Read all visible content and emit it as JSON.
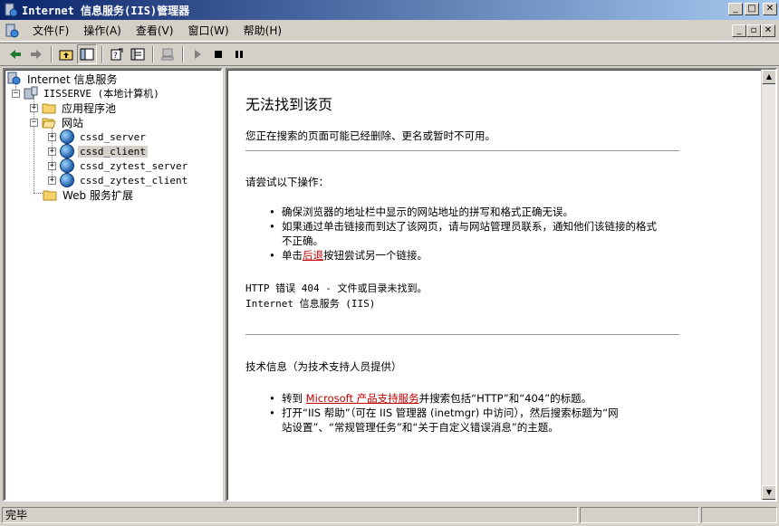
{
  "window": {
    "title": "Internet 信息服务(IIS)管理器",
    "minimize": "_",
    "maximize": "□",
    "close": "✕"
  },
  "menu": {
    "items": [
      "文件(F)",
      "操作(A)",
      "查看(V)",
      "窗口(W)",
      "帮助(H)"
    ],
    "restore_buttons": [
      "_",
      "▫",
      "✕"
    ]
  },
  "toolbar": {
    "icons": [
      "back-icon",
      "forward-icon",
      "up-folder-icon",
      "show-hide-tree-icon",
      "properties-icon",
      "export-list-icon",
      "computer-icon",
      "play-icon",
      "stop-icon",
      "pause-icon"
    ]
  },
  "tree": {
    "root": "Internet 信息服务",
    "server": "IISSERVE (本地计算机)",
    "app_pools": "应用程序池",
    "websites": "网站",
    "sites": [
      "cssd_server",
      "cssd_client",
      "cssd_zytest_server",
      "cssd_zytest_client"
    ],
    "selected_site": "cssd_client",
    "web_ext": "Web 服务扩展"
  },
  "content": {
    "heading": "无法找到该页",
    "intro": "您正在搜索的页面可能已经删除、更名或暂时不可用。",
    "try_heading": "请尝试以下操作：",
    "try_items": {
      "item1": "确保浏览器的地址栏中显示的网站地址的拼写和格式正确无误。",
      "item2_line1": "如果通过单击链接而到达了该网页，请与网站管理员联系，通知他们该链接的格式",
      "item2_line2": "不正确。",
      "item3_pre": "单击",
      "item3_link": "后退",
      "item3_post": "按钮尝试另一个链接。"
    },
    "error_line1": "HTTP 错误 404 - 文件或目录未找到。",
    "error_line2": "Internet 信息服务 (IIS)",
    "tech_heading": "技术信息（为技术支持人员提供）",
    "tech_items": {
      "item1_pre": "转到 ",
      "item1_link": "Microsoft 产品支持服务",
      "item1_post": "并搜索包括“HTTP”和“404”的标题。",
      "item2_line1": "打开“IIS 帮助”（可在 IIS 管理器 (inetmgr) 中访问），然后搜索标题为“网",
      "item2_line2": "站设置”、“常规管理任务”和“关于自定义错误消息”的主题。"
    }
  },
  "status": {
    "text": "完毕"
  },
  "colors": {
    "title_gradient_start": "#0a246a",
    "title_gradient_end": "#a6caf0",
    "chrome": "#d4d0c8",
    "link": "#c00000"
  }
}
